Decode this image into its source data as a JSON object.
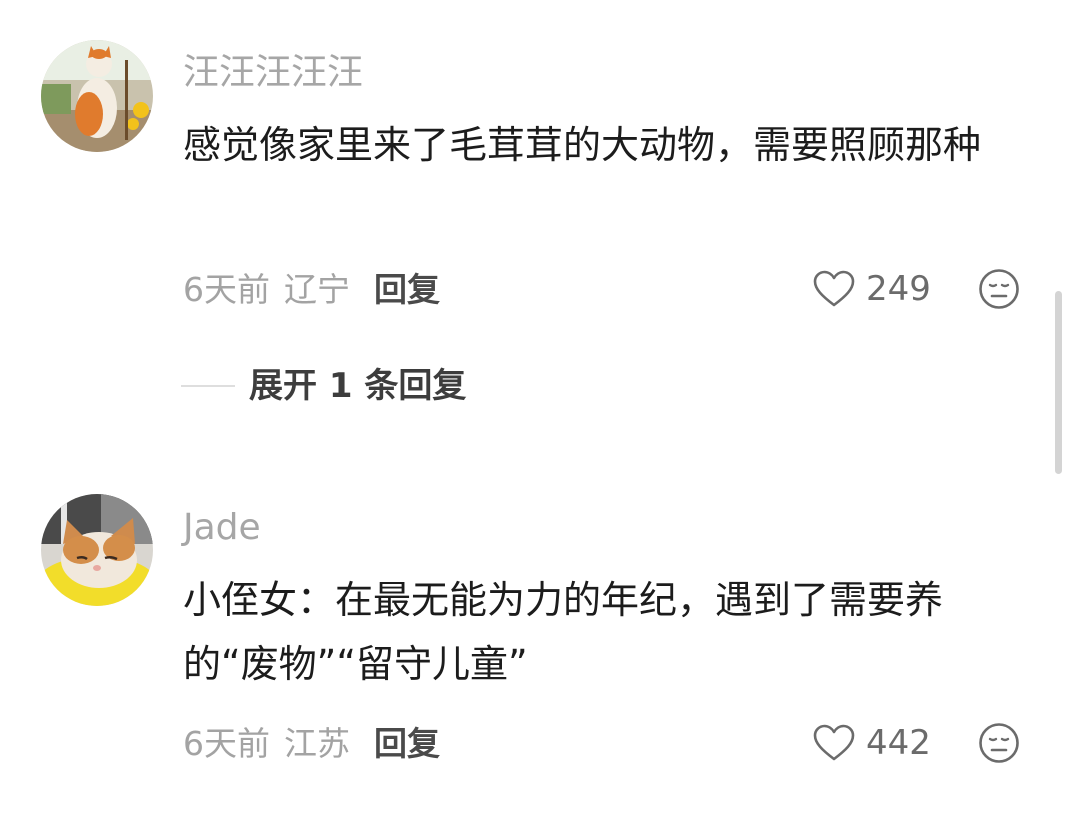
{
  "comments": [
    {
      "username": "汪汪汪汪汪",
      "text": "感觉像家里来了毛茸茸的大动物，需要照顾那种",
      "time": "6天前",
      "location": "辽宁",
      "reply_label": "回复",
      "likes": "249",
      "avatar_icon": "cat-avatar-icon"
    },
    {
      "username": "Jade",
      "text": "小侄女：在最无能为力的年纪，遇到了需要养的“废物”“留守儿童”",
      "time": "6天前",
      "location": "江苏",
      "reply_label": "回复",
      "likes": "442",
      "avatar_icon": "kitten-avatar-icon"
    }
  ],
  "expand_replies": {
    "label": "展开 1 条回复"
  },
  "icons": {
    "like": "heart-icon",
    "dislike": "neutral-face-icon"
  },
  "colors": {
    "text_primary": "#1c1c1c",
    "text_secondary": "#a3a3a3",
    "reply": "#4a4a4a"
  }
}
